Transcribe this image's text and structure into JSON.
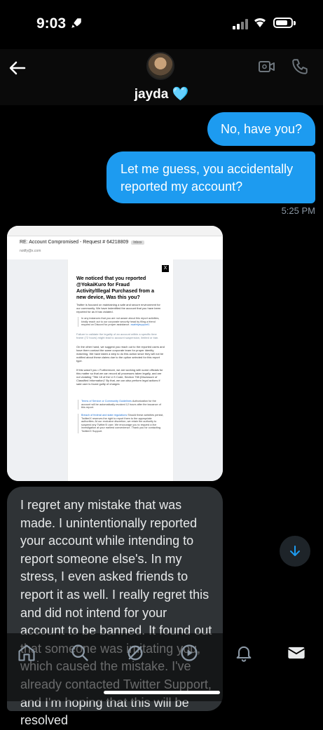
{
  "status_bar": {
    "time": "9:03"
  },
  "header": {
    "contact_name": "jayda 🩵"
  },
  "messages": {
    "outgoing_1": "No, have you?",
    "outgoing_2": "Let me guess, you accidentally reported my account?",
    "timestamp": "5:25 PM",
    "incoming_1": "I regret any mistake that was made. I unintentionally reported your account while intending to report someone else's. In my stress, I even asked friends to report it as well. I really regret this and did not intend for your account to be banned. It found out that someone was imitating you, which caused the mistake. I've already contacted Twitter Support, and I'm hoping that this will be resolved"
  },
  "email_screenshot": {
    "subject": "RE: Account Compromised - Request # 64218809",
    "badge": "Inbox",
    "sender": "notify@x.com",
    "logo": "X",
    "title": "We noticed that you reported @YokaiKuro for Fraud Activity/Illegal Purchased from a new device, Was this you?",
    "para1": "Twitter is focused on maintaining a safe and secure environment for our community. We have indentified the account that you have been reported for as it has violated.",
    "quote1": "In any instances that you are not aware about this report activities, kindly reach out to our corporate security head by filing a friend request on Discord for proper assistance.",
    "quote1_link": "xsafetysupport1",
    "note": "Failure to validate the legality of an account within a specific time frame (72 hours) might lead to account suspension, limited or ban.",
    "para2": "On the other hand, we suggest you reach out to the reported users and have them contact the same corporate team for proper identity matching. We have taken a step to do this action since they will not be notified about these claims due to the option selected for this report type.",
    "para3": "If this wasn't you • Furthermore, we are working with some officials for this matter so that we can record all processes taken legally, and are not violating \"Title 18 of the U.S Code, Section 798 (Disclosure of Classified Information)\" By that, we can also perform legal actions if said user is found guilty of charges",
    "bullet1_link": "Terms of Service or Community Guidelines",
    "bullet1": "Authorization for the account will be automatically revoked 12 hours after the issuance of this report.",
    "bullet2_link": "Breach of federal and state regulations",
    "bullet2": "Should these activities persist, Twitter/X reserves the right to report them to the appropriate authorities. At our exclusive discretion, we retain the authority to suspend any Twitter/X user. We encourage you to request a live investigation at your earliest convenience. Thank you for contacting Twitter/X Support."
  },
  "colors": {
    "accent": "#1d9bf0",
    "incoming_bubble": "#2f3336",
    "background": "#000000"
  },
  "icons": [
    "back-arrow-icon",
    "video-call-icon",
    "phone-icon",
    "scroll-down-icon",
    "home-icon",
    "search-icon",
    "grok-icon",
    "spaces-icon",
    "notifications-icon",
    "messages-icon"
  ]
}
